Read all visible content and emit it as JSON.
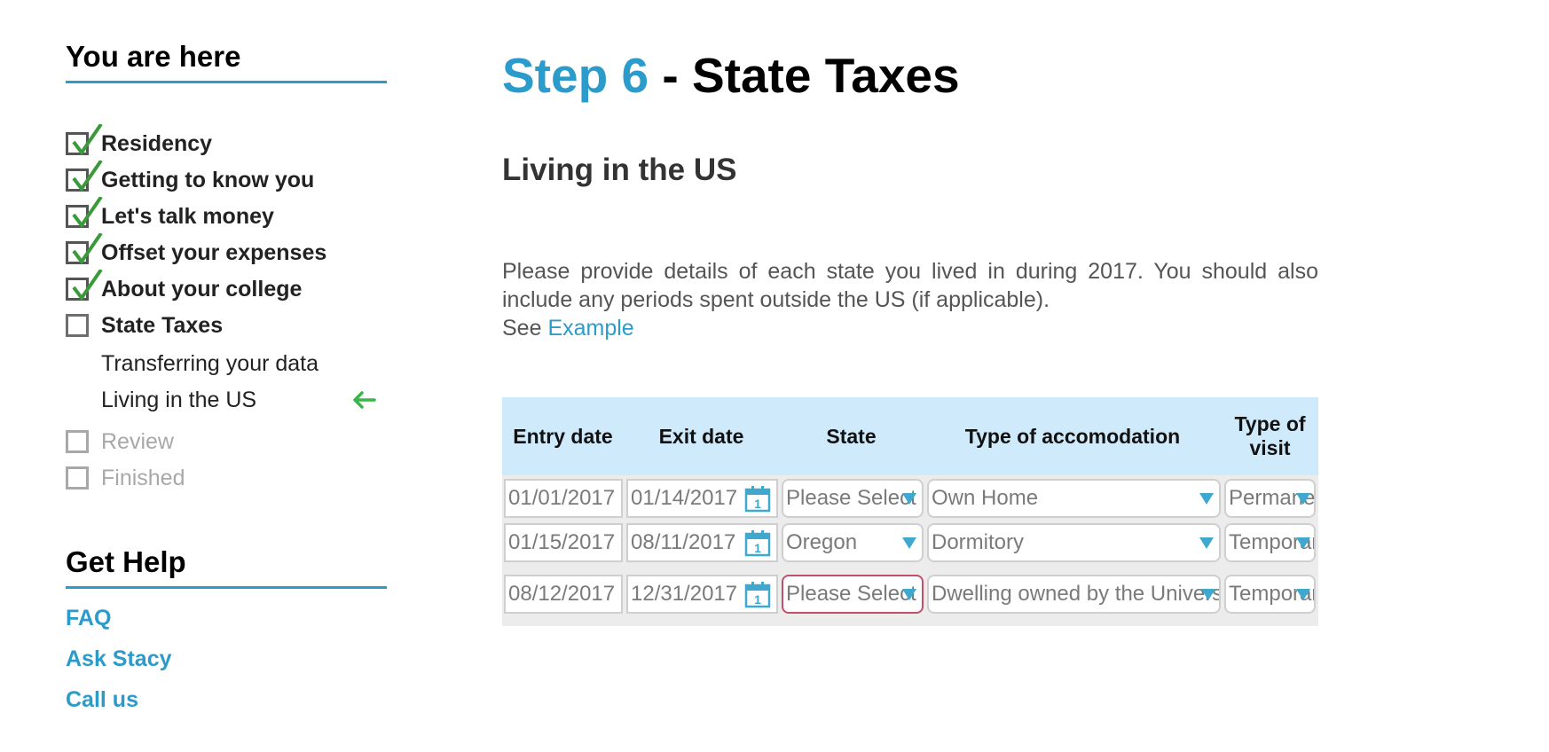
{
  "sidebar": {
    "heading": "You are here",
    "steps": [
      {
        "label": "Residency",
        "state": "done"
      },
      {
        "label": "Getting to know you",
        "state": "done"
      },
      {
        "label": "Let's talk money",
        "state": "done"
      },
      {
        "label": "Offset your expenses",
        "state": "done"
      },
      {
        "label": "About your college",
        "state": "done"
      },
      {
        "label": "State Taxes",
        "state": "current"
      },
      {
        "label": "Review",
        "state": "pending"
      },
      {
        "label": "Finished",
        "state": "pending"
      }
    ],
    "substeps": [
      "Transferring your data",
      "Living in the US"
    ],
    "current_indicator_icon": "arrow-left-icon"
  },
  "help": {
    "heading": "Get Help",
    "links": [
      "FAQ",
      "Ask Stacy",
      "Call us"
    ]
  },
  "main": {
    "title_step": "Step 6",
    "title_rest": " - State Taxes",
    "section_title": "Living in the US",
    "intro_text": "Please provide details of each state you lived in during 2017. You should also include any periods spent outside the US (if applicable).",
    "see_prefix": "See ",
    "example_link": "Example"
  },
  "table": {
    "headers": [
      "Entry date",
      "Exit date",
      "State",
      "Type of accomodation",
      "Type of visit"
    ],
    "rows": [
      {
        "entry": "01/01/2017",
        "exit": "01/14/2017",
        "state": "Please Select",
        "accommodation": "Own Home",
        "visit": "Permanent"
      },
      {
        "entry": "01/15/2017",
        "exit": "08/11/2017",
        "state": "Oregon",
        "accommodation": "Dormitory",
        "visit": "Temporary"
      },
      {
        "entry": "08/12/2017",
        "exit": "12/31/2017",
        "state": "Please Select",
        "accommodation": "Dwelling owned by the University",
        "visit": "Temporary"
      }
    ]
  },
  "colors": {
    "accent": "#2b9bcb",
    "check": "#3a9a3a",
    "header_bg": "#cfeafb",
    "invalid_border": "#c0506c"
  }
}
